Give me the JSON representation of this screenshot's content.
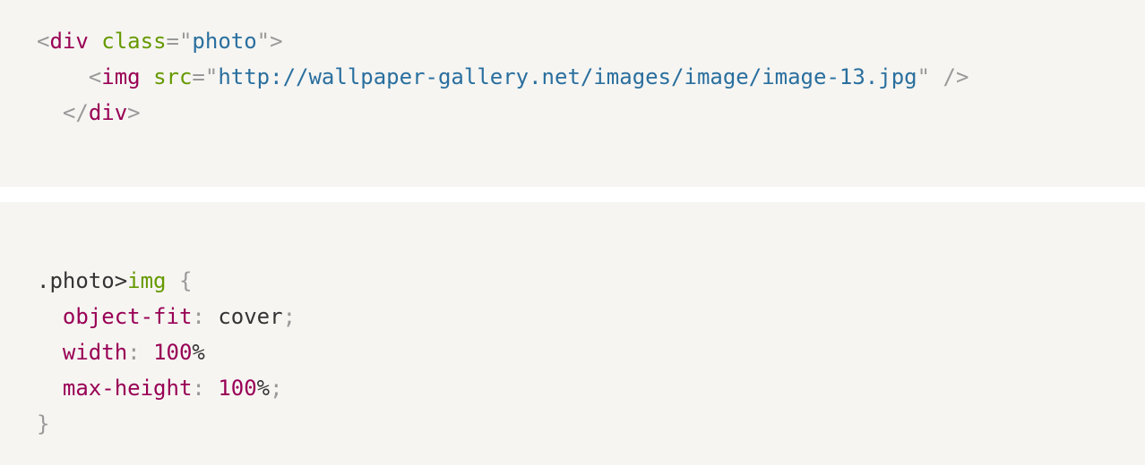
{
  "html_snippet": {
    "line1": {
      "open_bracket": "<",
      "tag": "div",
      "attr": "class",
      "eq": "=",
      "quote_open": "\"",
      "value": "photo",
      "quote_close": "\"",
      "close_bracket": ">"
    },
    "line2": {
      "indent": "    ",
      "open_bracket": "<",
      "tag": "img",
      "attr": "src",
      "eq": "=",
      "quote_open": "\"",
      "value": "http://wallpaper-gallery.net/images/image/image-13.jpg",
      "quote_close": "\"",
      "self_close": "/>"
    },
    "line3": {
      "indent": "  ",
      "open_bracket": "</",
      "tag": "div",
      "close_bracket": ">"
    }
  },
  "css_snippet": {
    "selector_class": ".photo",
    "combinator": ">",
    "selector_tag": "img",
    "open_brace": "{",
    "declarations": [
      {
        "property": "object-fit",
        "colon": ":",
        "value": "cover",
        "value_kind": "keyword",
        "semicolon": ";"
      },
      {
        "property": "width",
        "colon": ":",
        "number": "100",
        "unit": "%",
        "semicolon": ""
      },
      {
        "property": "max-height",
        "colon": ":",
        "number": "100",
        "unit": "%",
        "semicolon": ";"
      }
    ],
    "close_brace": "}"
  }
}
